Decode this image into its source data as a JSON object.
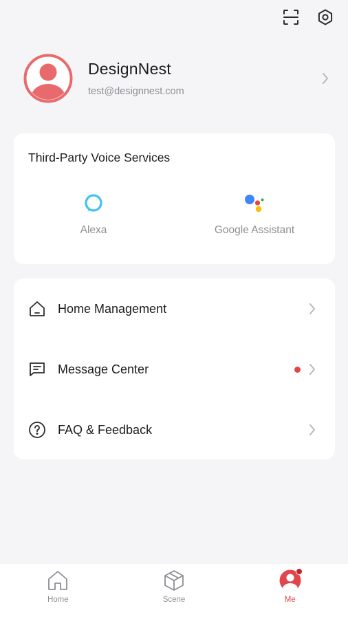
{
  "header": {
    "scan_icon": "scan-icon",
    "settings_icon": "settings-gear-icon"
  },
  "profile": {
    "name": "DesignNest",
    "email": "test@designnest.com",
    "avatar_color": "#e96a6c"
  },
  "voice_services": {
    "title": "Third-Party Voice Services",
    "items": [
      {
        "label": "Alexa",
        "icon": "alexa-icon",
        "color": "#3ec3f0"
      },
      {
        "label": "Google Assistant",
        "icon": "google-assistant-icon"
      }
    ]
  },
  "menu": {
    "items": [
      {
        "label": "Home Management",
        "icon": "home-outline-icon",
        "has_dot": false
      },
      {
        "label": "Message Center",
        "icon": "message-icon",
        "has_dot": true
      },
      {
        "label": "FAQ & Feedback",
        "icon": "help-circle-icon",
        "has_dot": false
      }
    ]
  },
  "bottom_nav": {
    "items": [
      {
        "label": "Home",
        "icon": "home-tab-icon",
        "active": false
      },
      {
        "label": "Scene",
        "icon": "scene-cube-icon",
        "active": false
      },
      {
        "label": "Me",
        "icon": "me-profile-icon",
        "active": true,
        "badge": true
      }
    ]
  },
  "colors": {
    "accent": "#e0474c",
    "background": "#f5f5f7",
    "card": "#ffffff",
    "muted_text": "#8e8e93"
  }
}
